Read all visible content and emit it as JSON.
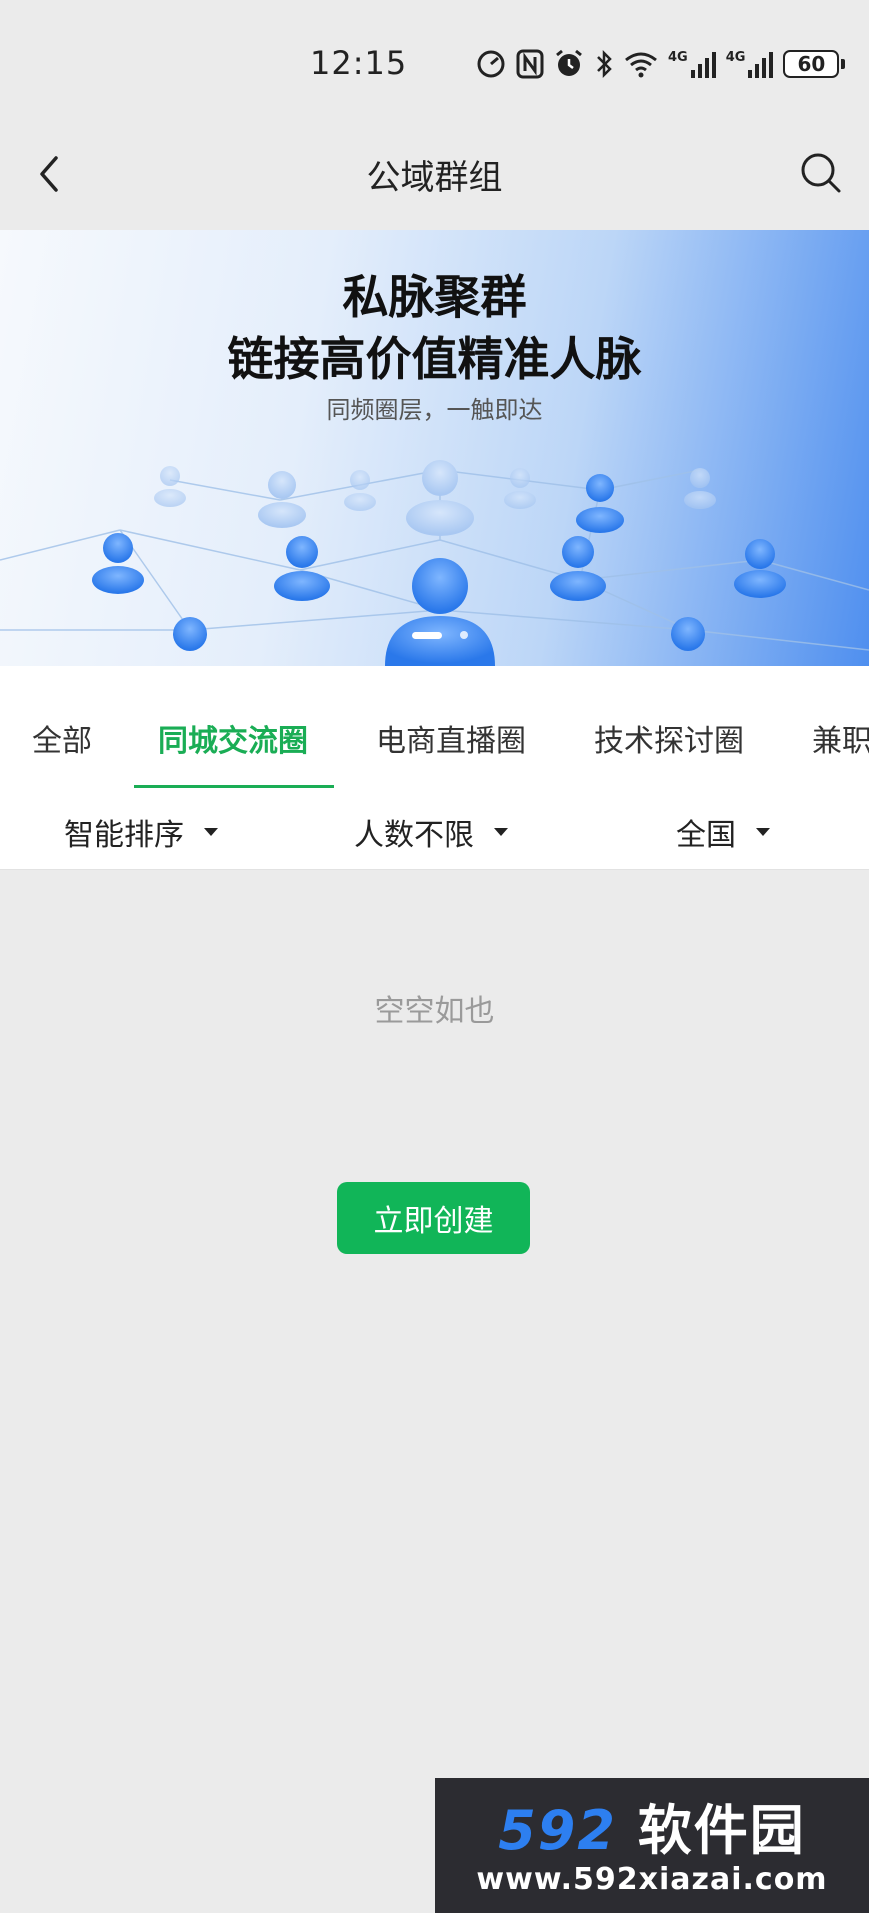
{
  "status_bar": {
    "time": "12:15",
    "signal_1_label": "4G",
    "signal_2_label": "4G",
    "battery": "60",
    "icons": [
      "speed-icon",
      "nfc-icon",
      "alarm-icon",
      "bluetooth-icon",
      "wifi-icon",
      "signal-icon",
      "signal-icon",
      "battery-icon"
    ]
  },
  "nav": {
    "title": "公域群组",
    "back_icon": "chevron-left-icon",
    "search_icon": "search-icon"
  },
  "banner": {
    "title_line1": "私脉聚群",
    "title_line2": "链接高价值精准人脉",
    "subtitle": "同频圈层，一触即达"
  },
  "tabs": [
    {
      "label": "全部",
      "active": false
    },
    {
      "label": "同城交流圈",
      "active": true
    },
    {
      "label": "电商直播圈",
      "active": false
    },
    {
      "label": "技术探讨圈",
      "active": false
    },
    {
      "label": "兼职",
      "active": false
    }
  ],
  "filters": {
    "sort": "智能排序",
    "members": "人数不限",
    "region": "全国"
  },
  "empty": {
    "text": "空空如也",
    "create_label": "立即创建"
  },
  "watermark": {
    "brand_num": "592",
    "brand_cn": "软件园",
    "url": "www.592xiazai.com"
  },
  "colors": {
    "accent": "#1aad55",
    "button": "#11b558",
    "background": "#ebebeb",
    "watermark_blue": "#2d7ff0"
  }
}
